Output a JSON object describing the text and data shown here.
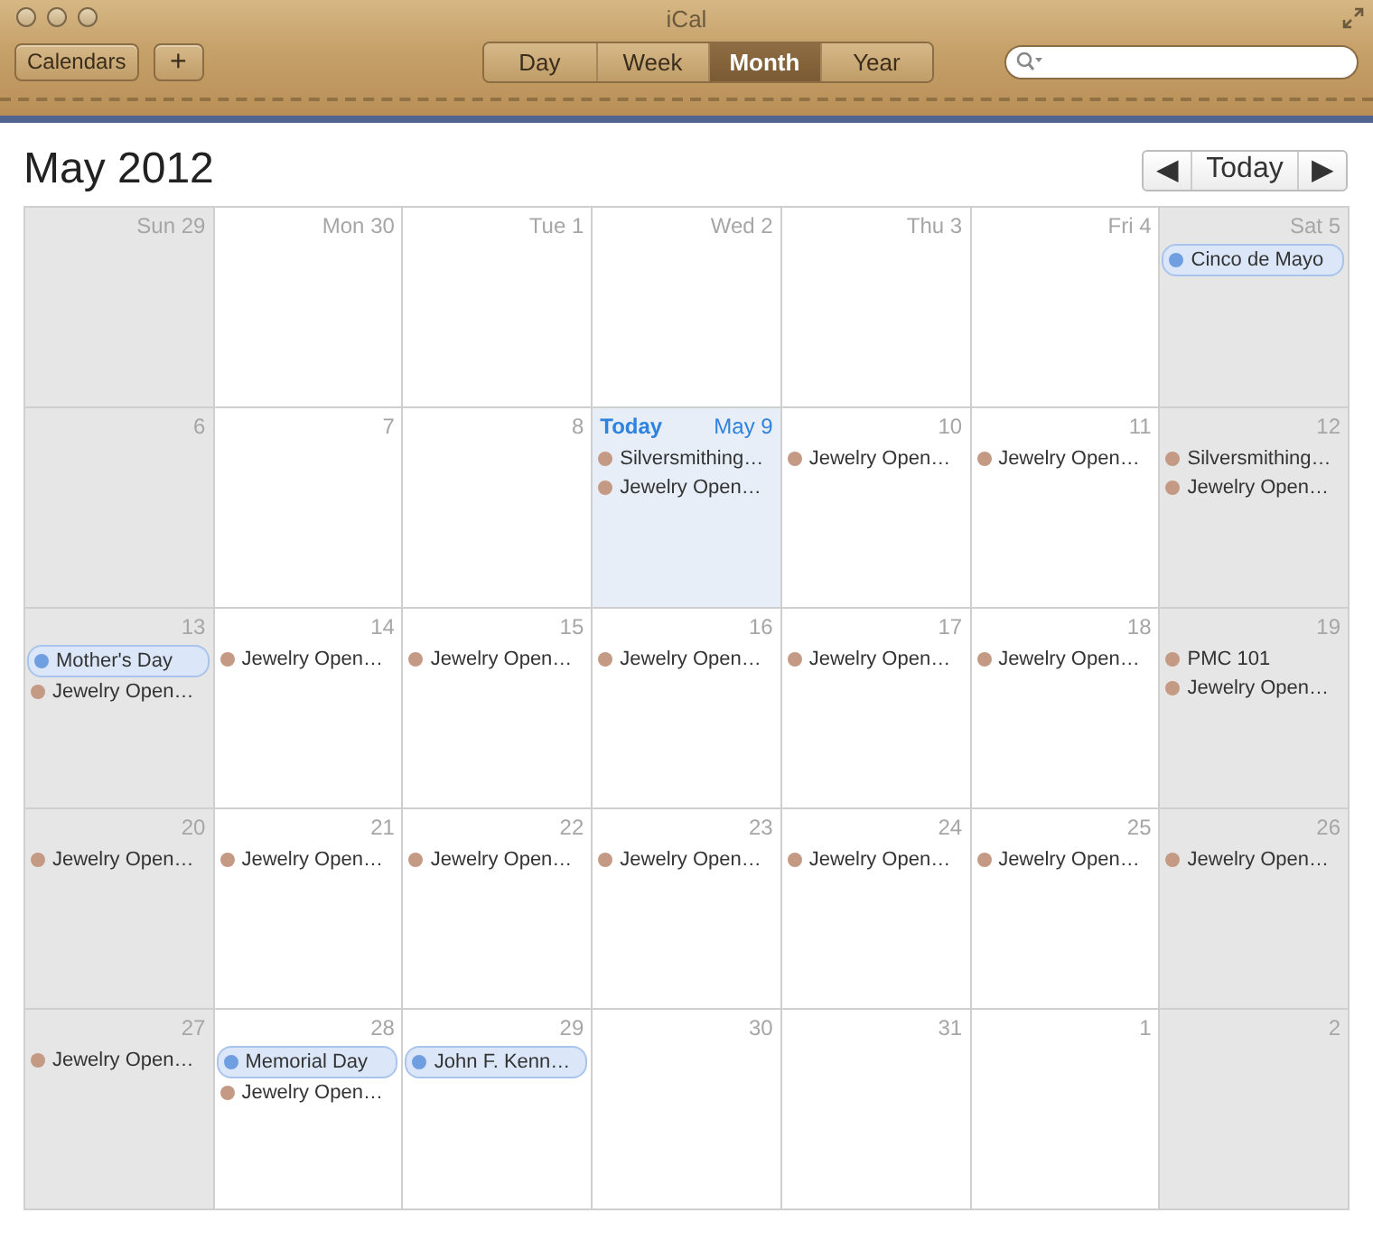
{
  "window": {
    "title": "iCal"
  },
  "toolbar": {
    "calendars_button": "Calendars",
    "add_button": "+",
    "views": [
      {
        "label": "Day",
        "selected": false
      },
      {
        "label": "Week",
        "selected": false
      },
      {
        "label": "Month",
        "selected": true
      },
      {
        "label": "Year",
        "selected": false
      }
    ]
  },
  "header": {
    "title": "May 2012",
    "today_button": "Today",
    "prev_button": "◀",
    "next_button": "▶"
  },
  "weeks": [
    [
      {
        "label": "Sun 29",
        "weekend": true,
        "today": false
      },
      {
        "label": "Mon 30",
        "weekend": false,
        "today": false
      },
      {
        "label": "Tue 1",
        "weekend": false,
        "today": false
      },
      {
        "label": "Wed 2",
        "weekend": false,
        "today": false
      },
      {
        "label": "Thu 3",
        "weekend": false,
        "today": false
      },
      {
        "label": "Fri 4",
        "weekend": false,
        "today": false
      },
      {
        "label": "Sat 5",
        "weekend": true,
        "today": false,
        "events": [
          {
            "title": "Cinco de Mayo",
            "kind": "allday",
            "color": "#6f9fe0"
          }
        ]
      }
    ],
    [
      {
        "label": "6",
        "weekend": true,
        "today": false
      },
      {
        "label": "7",
        "weekend": false,
        "today": false
      },
      {
        "label": "8",
        "weekend": false,
        "today": false
      },
      {
        "label": "May 9",
        "today": true,
        "today_label": "Today",
        "events": [
          {
            "title": "Silversmithing…",
            "kind": "timed",
            "color": "#c49a85"
          },
          {
            "title": "Jewelry Open…",
            "kind": "timed",
            "color": "#c49a85"
          }
        ]
      },
      {
        "label": "10",
        "weekend": false,
        "today": false,
        "events": [
          {
            "title": "Jewelry Open…",
            "kind": "timed",
            "color": "#c49a85"
          }
        ]
      },
      {
        "label": "11",
        "weekend": false,
        "today": false,
        "events": [
          {
            "title": "Jewelry Open…",
            "kind": "timed",
            "color": "#c49a85"
          }
        ]
      },
      {
        "label": "12",
        "weekend": true,
        "today": false,
        "events": [
          {
            "title": "Silversmithing…",
            "kind": "timed",
            "color": "#c49a85"
          },
          {
            "title": "Jewelry Open…",
            "kind": "timed",
            "color": "#c49a85"
          }
        ]
      }
    ],
    [
      {
        "label": "13",
        "weekend": true,
        "today": false,
        "events": [
          {
            "title": "Mother's Day",
            "kind": "allday",
            "color": "#6f9fe0"
          },
          {
            "title": "Jewelry Open…",
            "kind": "timed",
            "color": "#c49a85"
          }
        ]
      },
      {
        "label": "14",
        "weekend": false,
        "today": false,
        "events": [
          {
            "title": "Jewelry Open…",
            "kind": "timed",
            "color": "#c49a85"
          }
        ]
      },
      {
        "label": "15",
        "weekend": false,
        "today": false,
        "events": [
          {
            "title": "Jewelry Open…",
            "kind": "timed",
            "color": "#c49a85"
          }
        ]
      },
      {
        "label": "16",
        "weekend": false,
        "today": false,
        "events": [
          {
            "title": "Jewelry Open…",
            "kind": "timed",
            "color": "#c49a85"
          }
        ]
      },
      {
        "label": "17",
        "weekend": false,
        "today": false,
        "events": [
          {
            "title": "Jewelry Open…",
            "kind": "timed",
            "color": "#c49a85"
          }
        ]
      },
      {
        "label": "18",
        "weekend": false,
        "today": false,
        "events": [
          {
            "title": "Jewelry Open…",
            "kind": "timed",
            "color": "#c49a85"
          }
        ]
      },
      {
        "label": "19",
        "weekend": true,
        "today": false,
        "events": [
          {
            "title": "PMC 101",
            "kind": "timed",
            "color": "#c49a85"
          },
          {
            "title": "Jewelry Open…",
            "kind": "timed",
            "color": "#c49a85"
          }
        ]
      }
    ],
    [
      {
        "label": "20",
        "weekend": true,
        "today": false,
        "events": [
          {
            "title": "Jewelry Open…",
            "kind": "timed",
            "color": "#c49a85"
          }
        ]
      },
      {
        "label": "21",
        "weekend": false,
        "today": false,
        "events": [
          {
            "title": "Jewelry Open…",
            "kind": "timed",
            "color": "#c49a85"
          }
        ]
      },
      {
        "label": "22",
        "weekend": false,
        "today": false,
        "events": [
          {
            "title": "Jewelry Open…",
            "kind": "timed",
            "color": "#c49a85"
          }
        ]
      },
      {
        "label": "23",
        "weekend": false,
        "today": false,
        "events": [
          {
            "title": "Jewelry Open…",
            "kind": "timed",
            "color": "#c49a85"
          }
        ]
      },
      {
        "label": "24",
        "weekend": false,
        "today": false,
        "events": [
          {
            "title": "Jewelry Open…",
            "kind": "timed",
            "color": "#c49a85"
          }
        ]
      },
      {
        "label": "25",
        "weekend": false,
        "today": false,
        "events": [
          {
            "title": "Jewelry Open…",
            "kind": "timed",
            "color": "#c49a85"
          }
        ]
      },
      {
        "label": "26",
        "weekend": true,
        "today": false,
        "events": [
          {
            "title": "Jewelry Open…",
            "kind": "timed",
            "color": "#c49a85"
          }
        ]
      }
    ],
    [
      {
        "label": "27",
        "weekend": true,
        "today": false,
        "events": [
          {
            "title": "Jewelry Open…",
            "kind": "timed",
            "color": "#c49a85"
          }
        ]
      },
      {
        "label": "28",
        "weekend": false,
        "today": false,
        "events": [
          {
            "title": "Memorial Day",
            "kind": "allday",
            "color": "#6f9fe0"
          },
          {
            "title": "Jewelry Open…",
            "kind": "timed",
            "color": "#c49a85"
          }
        ]
      },
      {
        "label": "29",
        "weekend": false,
        "today": false,
        "events": [
          {
            "title": "John F. Kenn…",
            "kind": "allday",
            "color": "#6f9fe0"
          }
        ]
      },
      {
        "label": "30",
        "weekend": false,
        "today": false
      },
      {
        "label": "31",
        "weekend": false,
        "today": false
      },
      {
        "label": "1",
        "weekend": false,
        "today": false
      },
      {
        "label": "2",
        "weekend": true,
        "today": false
      }
    ]
  ]
}
